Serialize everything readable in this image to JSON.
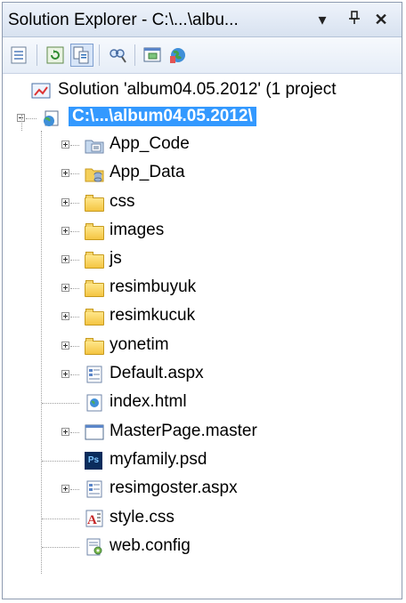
{
  "window": {
    "title": "Solution Explorer - C:\\...\\albu...",
    "dropdown_icon": "dropdown-arrow",
    "pin_icon": "pin",
    "close_icon": "close"
  },
  "toolbar": {
    "buttons": [
      {
        "name": "properties-icon"
      },
      {
        "name": "refresh-icon"
      },
      {
        "name": "show-all-files-icon"
      },
      {
        "name": "find-icon"
      },
      {
        "name": "view-designer-icon"
      },
      {
        "name": "web-config-tool-icon"
      }
    ]
  },
  "tree": {
    "solution": "Solution 'album04.05.2012' (1 project",
    "project": "C:\\...\\album04.05.2012\\",
    "items": [
      {
        "label": "App_Code",
        "icon": "special-folder-icon",
        "expandable": true
      },
      {
        "label": "App_Data",
        "icon": "data-folder-icon",
        "expandable": true
      },
      {
        "label": "css",
        "icon": "folder-icon",
        "expandable": true
      },
      {
        "label": "images",
        "icon": "folder-icon",
        "expandable": true
      },
      {
        "label": "js",
        "icon": "folder-icon",
        "expandable": true
      },
      {
        "label": "resimbuyuk",
        "icon": "folder-icon",
        "expandable": true
      },
      {
        "label": "resimkucuk",
        "icon": "folder-icon",
        "expandable": true
      },
      {
        "label": "yonetim",
        "icon": "folder-icon",
        "expandable": true
      },
      {
        "label": "Default.aspx",
        "icon": "aspx-file-icon",
        "expandable": true
      },
      {
        "label": "index.html",
        "icon": "html-file-icon",
        "expandable": false
      },
      {
        "label": "MasterPage.master",
        "icon": "master-file-icon",
        "expandable": true
      },
      {
        "label": "myfamily.psd",
        "icon": "psd-file-icon",
        "expandable": false
      },
      {
        "label": "resimgoster.aspx",
        "icon": "aspx-file-icon",
        "expandable": true
      },
      {
        "label": "style.css",
        "icon": "css-file-icon",
        "expandable": false
      },
      {
        "label": "web.config",
        "icon": "config-file-icon",
        "expandable": false
      }
    ]
  }
}
